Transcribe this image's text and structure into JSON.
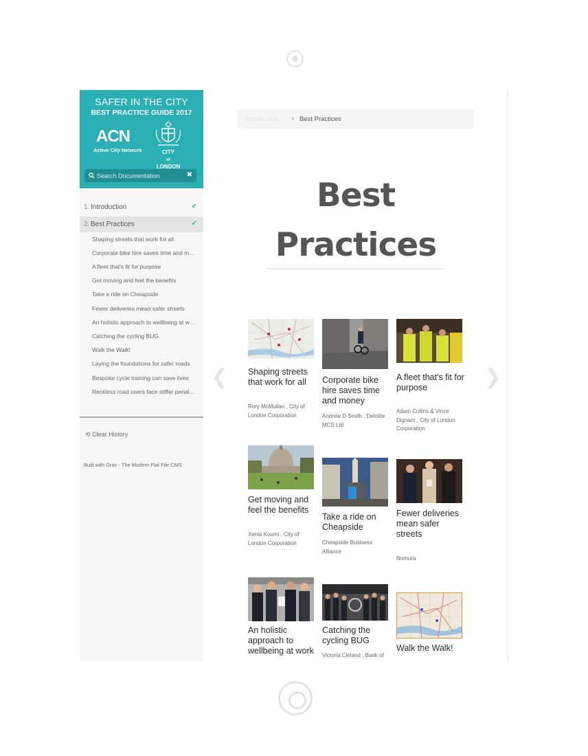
{
  "brand": {
    "title": "SAFER IN THE CITY",
    "subtitle": "BEST PRACTICE GUIDE 2017",
    "acn_mark": "ACN",
    "acn_label": "Active City Network",
    "col_label": "CITY\nof\nLONDON",
    "accent": "#2ab0b4"
  },
  "search": {
    "placeholder": "Search Documentation",
    "clear": "✖"
  },
  "nav": {
    "items": [
      {
        "num": "1.",
        "label": "Introduction",
        "check": "✔"
      },
      {
        "num": "2.",
        "label": "Best Practices",
        "check": "✔"
      }
    ],
    "subitems": [
      "Shaping streets that work for all",
      "Corporate bike hire saves time and money",
      "A fleet that's fit for purpose",
      "Get moving and feel the benefits",
      "Take a ride on Cheapside",
      "Fewer deliveries mean safer streets",
      "An holistic approach to wellbeing at work",
      "Catching the cycling BUG",
      "Walk the Walk!",
      "Laying the foundations for safer roads",
      "Bespoke cycle training can save lives",
      "Reckless road users face stiffer penalties"
    ],
    "clear_history": "Clear History",
    "built_with": "Built with Grav - The Modern Flat File CMS"
  },
  "breadcrumb": {
    "prev": "Introduction",
    "sep": "›",
    "current": "Best Practices"
  },
  "page": {
    "title": "Best Practices"
  },
  "arrows": {
    "prev": "❮",
    "next": "❯"
  },
  "cards": [
    {
      "title": "Shaping streets that work for all",
      "author": "Rory McMullan , City of London Corporation",
      "image": "map"
    },
    {
      "title": "Corporate bike hire saves time and money",
      "author": "Andrew D Smith , Deloitte MCS Ltd",
      "image": "cyclist-street"
    },
    {
      "title": "A fleet that's fit for purpose",
      "author": "Adam Collins & Vince Dignam , City of London Corporation",
      "image": "workers-truck"
    },
    {
      "title": "Get moving and feel the benefits",
      "author": "Xenia Koumi , City of London Corporation",
      "image": "cathedral-lawn"
    },
    {
      "title": "Take a ride on Cheapside",
      "author": "Cheapside Business Alliance",
      "image": "cheapside-street"
    },
    {
      "title": "Fewer deliveries mean safer streets",
      "author": "Nomura",
      "image": "award-people"
    },
    {
      "title": "An holistic approach to wellbeing at work",
      "author": "",
      "image": "award-group"
    },
    {
      "title": "Catching the cycling BUG",
      "author": "Victoria Cleland , Bank of",
      "image": "group-photo"
    },
    {
      "title": "Walk the Walk!",
      "author": "",
      "image": "walk-map"
    }
  ]
}
